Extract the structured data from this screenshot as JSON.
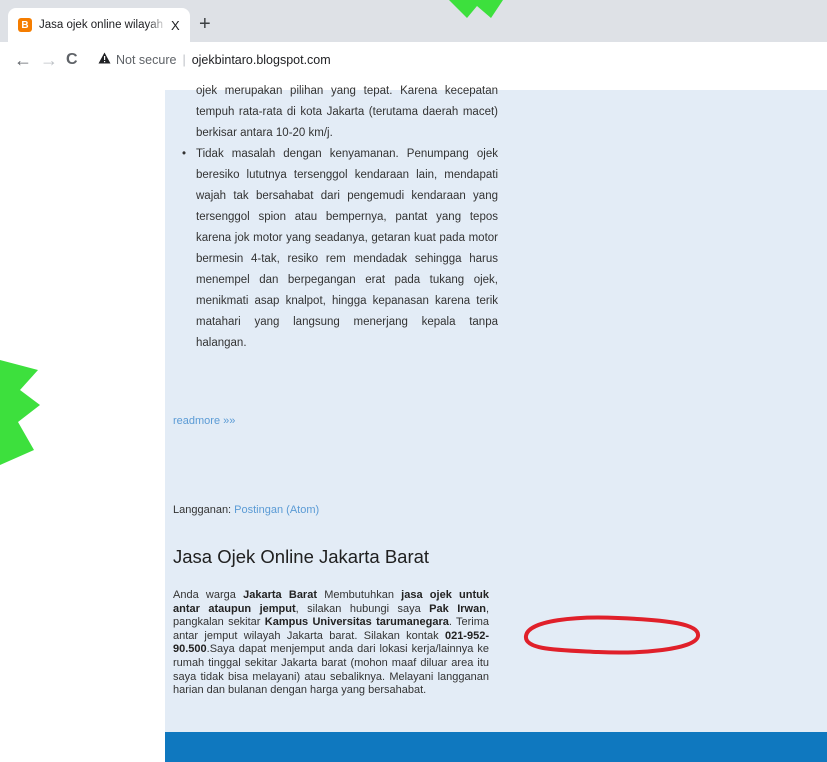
{
  "browser": {
    "tab_title": "Jasa ojek online wilayah Bintaro",
    "tab_close": "X",
    "new_tab": "+",
    "favicon_letter": "B",
    "back": "←",
    "forward": "→",
    "reload": "C",
    "security_icon": "warning-triangle-icon",
    "security_label": "Not secure",
    "separator": "|",
    "url": "ojekbintaro.blogspot.com"
  },
  "post": {
    "items": [
      {
        "bullet": "",
        "text": "ojek merupakan pilihan yang tepat. Karena kecepatan tempuh rata-rata di kota Jakarta (terutama daerah macet) berkisar antara 10-20 km/j."
      },
      {
        "bullet": "•",
        "text": "Tidak masalah dengan kenyamanan. Penumpang ojek beresiko lututnya tersenggol kendaraan lain, mendapati wajah tak bersahabat dari pengemudi kendaraan yang tersenggol spion atau bempernya, pantat yang tepos karena jok motor yang seadanya, getaran kuat pada motor bermesin 4-tak, resiko rem mendadak sehingga harus menempel dan berpegangan erat pada tukang ojek, menikmati asap knalpot, hingga kepanasan karena terik matahari yang langsung menerjang kepala tanpa halangan."
      }
    ],
    "readmore": "readmore »»",
    "subscribe_label": "Langganan: ",
    "subscribe_link": "Postingan (Atom)"
  },
  "widget": {
    "title": "Jasa Ojek Online Jakarta Barat",
    "p1": "Anda warga ",
    "b1": "Jakarta Barat",
    "p2": " Membutuhkan ",
    "b2": "jasa ojek untuk antar ataupun jemput",
    "p3": ", silakan hubungi saya ",
    "b3": "Pak Irwan",
    "p4": ", pangkalan sekitar ",
    "b4": "Kampus Universitas tarumanegara",
    "p5": ". Terima antar jemput wilayah Jakarta barat. Silakan kontak ",
    "b5": "021-952-90.500",
    "p6": ".Saya dapat menjemput anda dari lokasi kerja/lainnya ke rumah tinggal sekitar Jakarta barat (mohon maaf diluar area itu saya tidak bisa melayani) atau sebaliknya. Melayani langganan harian dan bulanan dengan harga yang bersahabat."
  },
  "colors": {
    "content_bg": "#e3ecf6",
    "link": "#5b9bd5",
    "footer": "#0f78bf",
    "annotation": "#e0202a",
    "watermark": "#2ee02e"
  }
}
